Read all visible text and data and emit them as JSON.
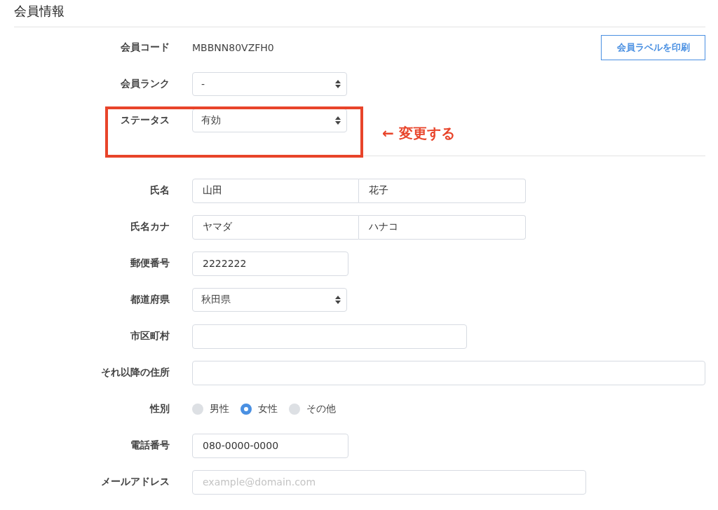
{
  "title": "会員情報",
  "print_button": "会員ラベルを印刷",
  "fields": [
    {
      "kind": "text",
      "label": "会員コード",
      "value": "MBBNN80VZFH0"
    },
    {
      "kind": "select",
      "label": "会員ランク",
      "value": "-"
    },
    {
      "kind": "select",
      "label": "ステータス",
      "value": "有効",
      "highlighted": true
    },
    {
      "kind": "separator"
    },
    {
      "kind": "pair",
      "label": "氏名",
      "values": [
        "山田",
        "花子"
      ]
    },
    {
      "kind": "pair",
      "label": "氏名カナ",
      "values": [
        "ヤマダ",
        "ハナコ"
      ]
    },
    {
      "kind": "input",
      "label": "郵便番号",
      "value": "2222222"
    },
    {
      "kind": "select",
      "label": "都道府県",
      "value": "秋田県"
    },
    {
      "kind": "input",
      "label": "市区町村"
    },
    {
      "kind": "input",
      "label": "それ以降の住所"
    },
    {
      "kind": "radio",
      "label": "性別",
      "options": [
        {
          "label": "男性",
          "selected": false
        },
        {
          "label": "女性",
          "selected": true
        },
        {
          "label": "その他",
          "selected": false
        }
      ]
    },
    {
      "kind": "input",
      "label": "電話番号",
      "value": "080-0000-0000"
    },
    {
      "kind": "input",
      "label": "メールアドレス",
      "placeholder": "example@domain.com"
    }
  ],
  "annotation": {
    "text": "← 変更する"
  }
}
